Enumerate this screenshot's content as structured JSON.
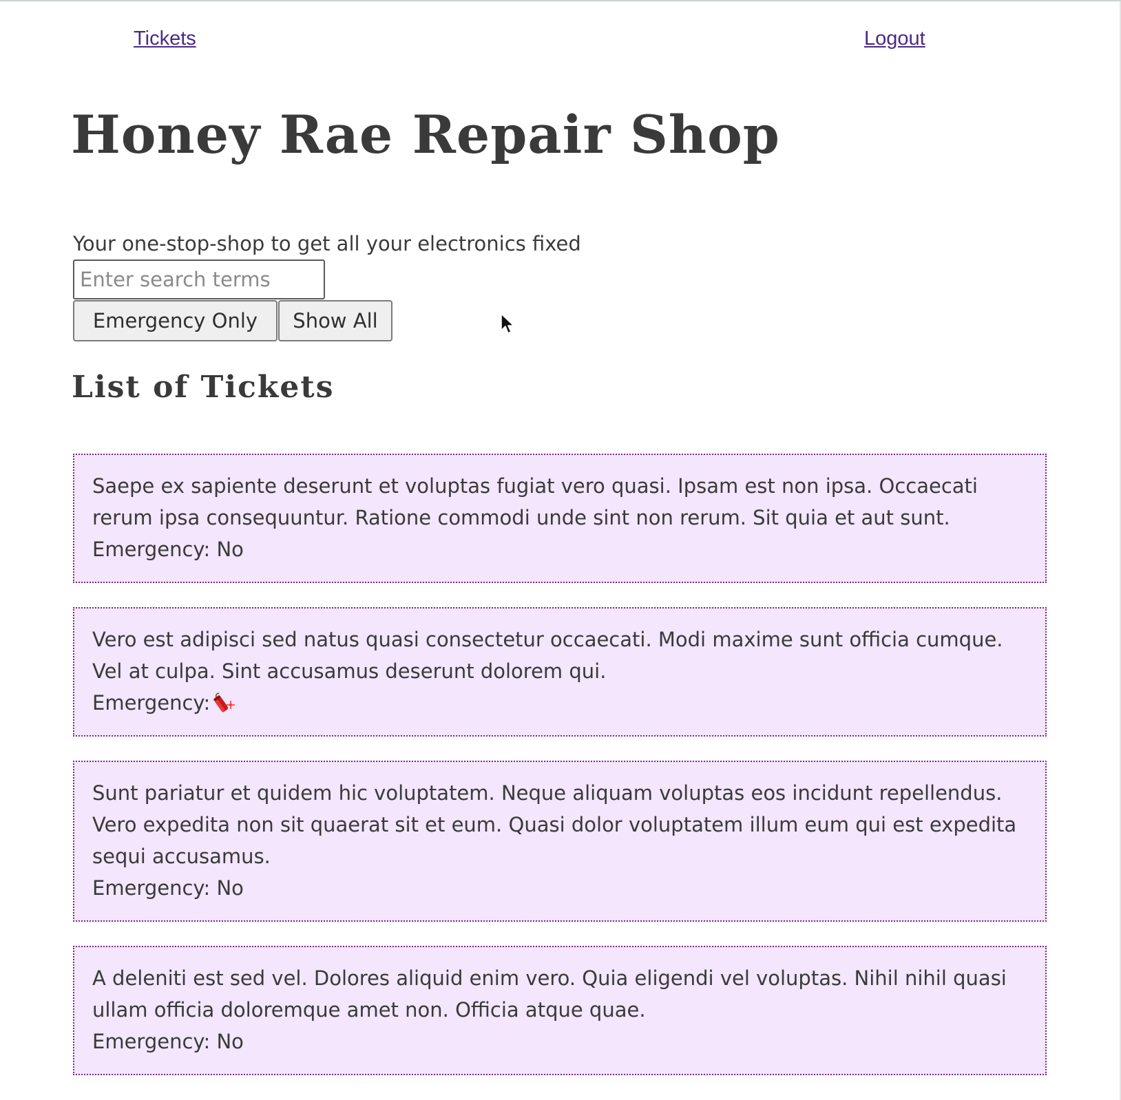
{
  "nav": {
    "tickets_label": "Tickets",
    "logout_label": "Logout"
  },
  "header": {
    "title": "Honey Rae Repair Shop",
    "tagline": "Your one-stop-shop to get all your electronics fixed"
  },
  "search": {
    "placeholder": "Enter search terms",
    "value": ""
  },
  "filters": {
    "emergency_label": "Emergency Only",
    "show_all_label": "Show All"
  },
  "list": {
    "heading": "List of Tickets",
    "tickets": [
      {
        "description": "Saepe ex sapiente deserunt et voluptas fugiat vero quasi. Ipsam est non ipsa. Occaecati rerum ipsa consequuntur. Ratione commodi unde sint non rerum. Sit quia et aut sunt.",
        "emergency_label": "Emergency: No"
      },
      {
        "description": "Vero est adipisci sed natus quasi consectetur occaecati. Modi maxime sunt officia cumque. Vel at culpa. Sint accusamus deserunt dolorem qui.",
        "emergency_label": "Emergency:",
        "emergency_icon": "dynamite-icon"
      },
      {
        "description": "Sunt pariatur et quidem hic voluptatem. Neque aliquam voluptas eos incidunt repellendus. Vero expedita non sit quaerat sit et eum. Quasi dolor voluptatem illum eum qui est expedita sequi accusamus.",
        "emergency_label": "Emergency: No"
      },
      {
        "description": "A deleniti est sed vel. Dolores aliquid enim vero. Quia eligendi vel voluptas. Nihil nihil quasi ullam officia doloremque amet non. Officia atque quae.",
        "emergency_label": "Emergency: No"
      }
    ]
  },
  "colors": {
    "link": "#4a2a84",
    "ticket_background": "#f3e6fd",
    "ticket_border": "#7a2a82",
    "text": "#3a3a3a"
  }
}
